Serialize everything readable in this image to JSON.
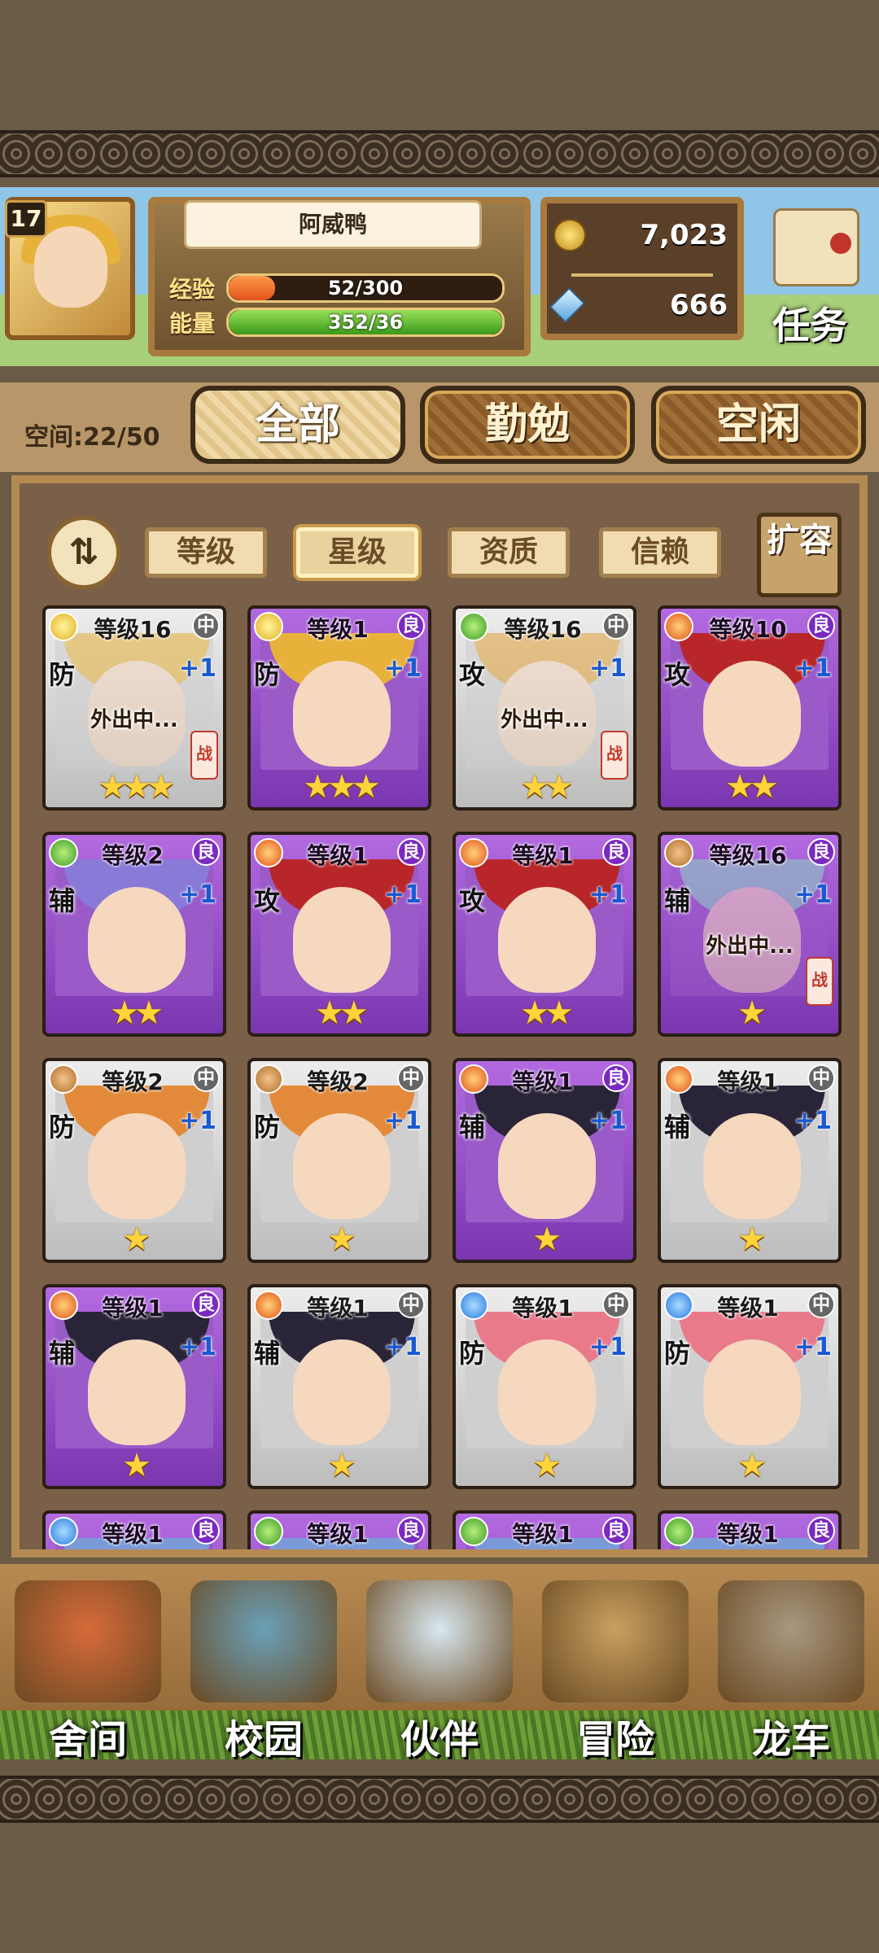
{
  "player": {
    "level": "17",
    "name": "阿威鸭",
    "exp_label": "经验",
    "exp_text": "52/300",
    "exp_fraction": 0.17,
    "energy_label": "能量",
    "energy_text": "352/36",
    "energy_fraction": 1.0,
    "gold": "7,023",
    "gems": "666",
    "task_label": "任务"
  },
  "tabs": {
    "space": "空间:22/50",
    "all": "全部",
    "diligent": "勤勉",
    "idle": "空闲"
  },
  "filters": {
    "sort_icon": "⇅",
    "level": "等级",
    "star": "星级",
    "quality": "资质",
    "trust": "信赖",
    "expand": "扩容"
  },
  "cards": [
    {
      "element": "light",
      "level": "等级16",
      "rarity": "中",
      "role": "防",
      "plus": "+1",
      "away": "外出中...",
      "battle": "战",
      "stars": 3,
      "hair": "#e8b23a"
    },
    {
      "element": "light",
      "level": "等级1",
      "rarity": "良",
      "role": "防",
      "plus": "+1",
      "away": "",
      "battle": "",
      "stars": 3,
      "hair": "#e8b23a"
    },
    {
      "element": "wind",
      "level": "等级16",
      "rarity": "中",
      "role": "攻",
      "plus": "+1",
      "away": "外出中...",
      "battle": "战",
      "stars": 2,
      "hair": "#e2a23a"
    },
    {
      "element": "fire",
      "level": "等级10",
      "rarity": "良",
      "role": "攻",
      "plus": "+1",
      "away": "",
      "battle": "",
      "stars": 2,
      "hair": "#b8262a"
    },
    {
      "element": "wind",
      "level": "等级2",
      "rarity": "良",
      "role": "辅",
      "plus": "+1",
      "away": "",
      "battle": "",
      "stars": 2,
      "hair": "#8a7ad8"
    },
    {
      "element": "fire",
      "level": "等级1",
      "rarity": "良",
      "role": "攻",
      "plus": "+1",
      "away": "",
      "battle": "",
      "stars": 2,
      "hair": "#b8262a"
    },
    {
      "element": "fire",
      "level": "等级1",
      "rarity": "良",
      "role": "攻",
      "plus": "+1",
      "away": "",
      "battle": "",
      "stars": 2,
      "hair": "#b8262a"
    },
    {
      "element": "earth",
      "level": "等级16",
      "rarity": "良",
      "role": "辅",
      "plus": "+1",
      "away": "外出中...",
      "battle": "战",
      "stars": 1,
      "hair": "#8ad6c0"
    },
    {
      "element": "earth",
      "level": "等级2",
      "rarity": "中",
      "role": "防",
      "plus": "+1",
      "away": "",
      "battle": "",
      "stars": 1,
      "hair": "#e28a3a"
    },
    {
      "element": "earth",
      "level": "等级2",
      "rarity": "中",
      "role": "防",
      "plus": "+1",
      "away": "",
      "battle": "",
      "stars": 1,
      "hair": "#e28a3a"
    },
    {
      "element": "fire",
      "level": "等级1",
      "rarity": "良",
      "role": "辅",
      "plus": "+1",
      "away": "",
      "battle": "",
      "stars": 1,
      "hair": "#2a2438"
    },
    {
      "element": "fire",
      "level": "等级1",
      "rarity": "中",
      "role": "辅",
      "plus": "+1",
      "away": "",
      "battle": "",
      "stars": 1,
      "hair": "#2a2438"
    },
    {
      "element": "fire",
      "level": "等级1",
      "rarity": "良",
      "role": "辅",
      "plus": "+1",
      "away": "",
      "battle": "",
      "stars": 1,
      "hair": "#2a2438"
    },
    {
      "element": "fire",
      "level": "等级1",
      "rarity": "中",
      "role": "辅",
      "plus": "+1",
      "away": "",
      "battle": "",
      "stars": 1,
      "hair": "#2a2438"
    },
    {
      "element": "water",
      "level": "等级1",
      "rarity": "中",
      "role": "防",
      "plus": "+1",
      "away": "",
      "battle": "",
      "stars": 1,
      "hair": "#e87a8a"
    },
    {
      "element": "water",
      "level": "等级1",
      "rarity": "中",
      "role": "防",
      "plus": "+1",
      "away": "",
      "battle": "",
      "stars": 1,
      "hair": "#e87a8a"
    },
    {
      "element": "water",
      "level": "等级1",
      "rarity": "良",
      "role": "",
      "plus": "",
      "away": "",
      "battle": "",
      "stars": 0,
      "hair": "#7a9ad8"
    },
    {
      "element": "wind",
      "level": "等级1",
      "rarity": "良",
      "role": "",
      "plus": "",
      "away": "",
      "battle": "",
      "stars": 0,
      "hair": "#7a9ad8"
    },
    {
      "element": "wind",
      "level": "等级1",
      "rarity": "良",
      "role": "",
      "plus": "",
      "away": "",
      "battle": "",
      "stars": 0,
      "hair": "#7a9ad8"
    },
    {
      "element": "wind",
      "level": "等级1",
      "rarity": "良",
      "role": "",
      "plus": "",
      "away": "",
      "battle": "",
      "stars": 0,
      "hair": "#7a9ad8"
    }
  ],
  "nav": [
    {
      "label": "舍间",
      "icon": "house-icon",
      "color": "#d86a3a"
    },
    {
      "label": "校园",
      "icon": "school-icon",
      "color": "#6aa0b8"
    },
    {
      "label": "伙伴",
      "icon": "partner-icon",
      "color": "#d8e8f0"
    },
    {
      "label": "冒险",
      "icon": "adventure-icon",
      "color": "#c8a060"
    },
    {
      "label": "龙车",
      "icon": "dragon-cart-icon",
      "color": "#a89880"
    }
  ]
}
